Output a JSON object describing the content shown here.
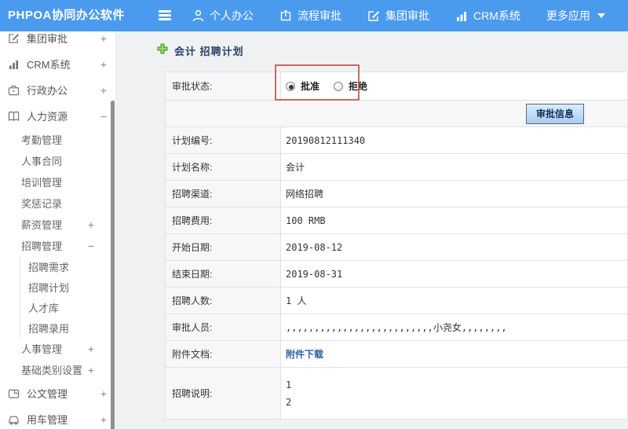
{
  "header": {
    "logo": "PHPOA协同办公软件",
    "nav": [
      {
        "label": "个人办公",
        "icon": "person-icon"
      },
      {
        "label": "流程审批",
        "icon": "flow-approval-icon"
      },
      {
        "label": "集团审批",
        "icon": "edit-square-icon"
      },
      {
        "label": "CRM系统",
        "icon": "bar-chart-icon"
      },
      {
        "label": "更多应用",
        "icon": "caret-down-icon"
      }
    ]
  },
  "sidebar": {
    "items": [
      {
        "label": "集团审批",
        "exp": "+",
        "icon": "edit-square-icon"
      },
      {
        "label": "CRM系统",
        "exp": "+",
        "icon": "bar-chart-icon"
      },
      {
        "label": "行政办公",
        "exp": "+",
        "icon": "briefcase-icon"
      },
      {
        "label": "人力资源",
        "exp": "−",
        "icon": "book-icon"
      },
      {
        "label": "考勤管理"
      },
      {
        "label": "人事合同"
      },
      {
        "label": "培训管理"
      },
      {
        "label": "奖惩记录"
      },
      {
        "label": "薪资管理",
        "exp": "+"
      },
      {
        "label": "招聘管理",
        "exp": "−"
      },
      {
        "label": "招聘需求"
      },
      {
        "label": "招聘计划"
      },
      {
        "label": "人才库"
      },
      {
        "label": "招聘录用"
      },
      {
        "label": "人事管理",
        "exp": "+"
      },
      {
        "label": "基础类别设置",
        "exp": "+"
      },
      {
        "label": "公文管理",
        "exp": "+",
        "icon": "document-icon"
      },
      {
        "label": "用车管理",
        "exp": "+",
        "icon": "car-icon"
      }
    ]
  },
  "main": {
    "title": "会计 招聘计划",
    "approval": {
      "label": "审批状态:",
      "options": [
        {
          "label": "批准",
          "selected": true
        },
        {
          "label": "拒绝",
          "selected": false
        }
      ]
    },
    "approve_button": "审批信息",
    "fields": [
      {
        "label": "计划编号:",
        "value": "20190812111340"
      },
      {
        "label": "计划名称:",
        "value": "会计"
      },
      {
        "label": "招聘渠道:",
        "value": "网络招聘"
      },
      {
        "label": "招聘费用:",
        "value": "100 RMB"
      },
      {
        "label": "开始日期:",
        "value": "2019-08-12"
      },
      {
        "label": "结束日期:",
        "value": "2019-08-31"
      },
      {
        "label": "招聘人数:",
        "value": "1 人"
      },
      {
        "label": "审批人员:",
        "value": ",,,,,,,,,,,,,,,,,,,,,,,,,,小尧女,,,,,,,,"
      },
      {
        "label": "附件文档:",
        "value": "附件下载",
        "type": "link"
      },
      {
        "label": "招聘说明:",
        "lines": [
          "1",
          "2"
        ]
      }
    ]
  },
  "colors": {
    "header_blue": "#4a9bee",
    "title_navy": "#2e4168",
    "annotation_red": "#c0504d",
    "link_blue": "#2a64a8",
    "button_bg": "#a9cdee",
    "plus_green": "#6fbf44"
  }
}
